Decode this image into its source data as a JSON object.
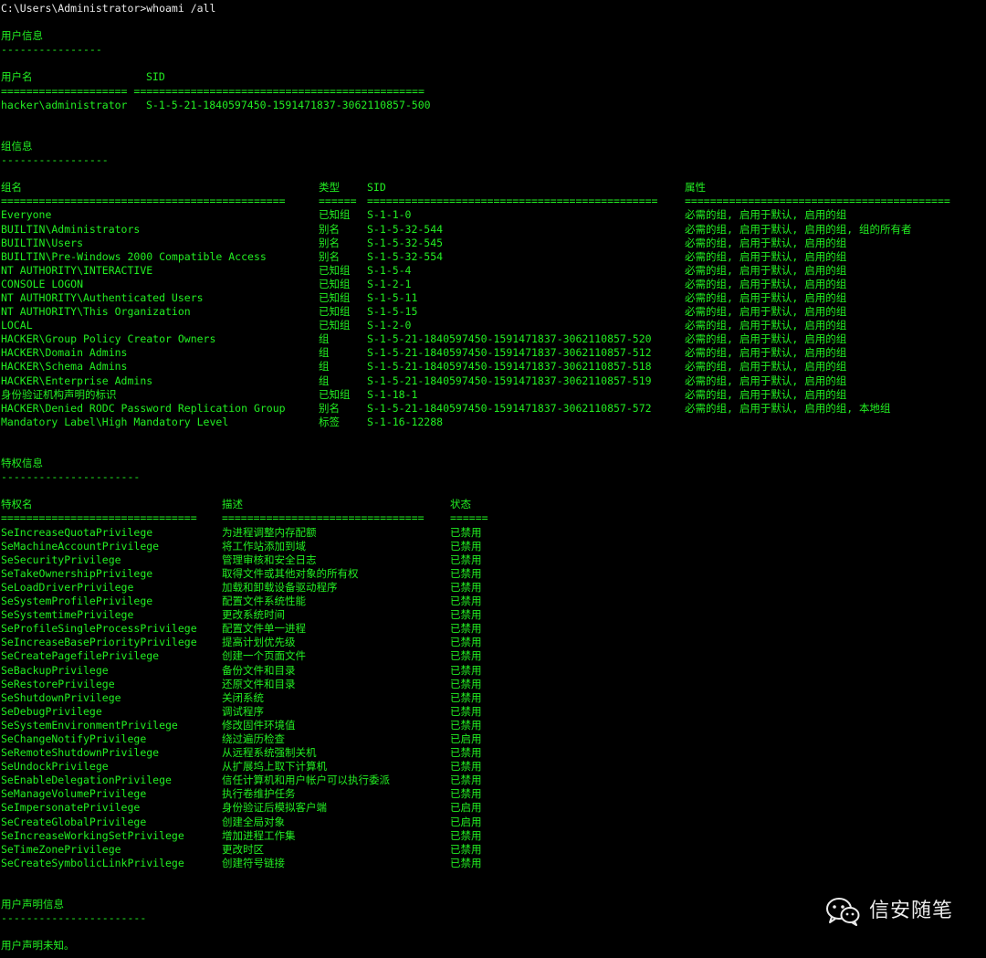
{
  "prompt": "C:\\Users\\Administrator>whoami /all",
  "user_section": {
    "title": "用户信息",
    "dashes": "----------------",
    "headers": {
      "name": "用户名",
      "sid": "SID"
    },
    "separator": "==================== ==============================================",
    "row": {
      "name": "hacker\\administrator",
      "sid": "S-1-5-21-1840597450-1591471837-3062110857-500"
    }
  },
  "group_section": {
    "title": "组信息",
    "dashes": "-----------------",
    "headers": {
      "name": "组名",
      "type": "类型",
      "sid": "SID",
      "attr": "属性"
    },
    "separators": {
      "name": "=============================================",
      "type": "======",
      "sid": "==============================================",
      "attr": "=========================================="
    },
    "rows": [
      {
        "name": "Everyone",
        "type": "已知组",
        "sid": "S-1-1-0",
        "attr": "必需的组, 启用于默认, 启用的组"
      },
      {
        "name": "BUILTIN\\Administrators",
        "type": "别名",
        "sid": "S-1-5-32-544",
        "attr": "必需的组, 启用于默认, 启用的组, 组的所有者"
      },
      {
        "name": "BUILTIN\\Users",
        "type": "别名",
        "sid": "S-1-5-32-545",
        "attr": "必需的组, 启用于默认, 启用的组"
      },
      {
        "name": "BUILTIN\\Pre-Windows 2000 Compatible Access",
        "type": "别名",
        "sid": "S-1-5-32-554",
        "attr": "必需的组, 启用于默认, 启用的组"
      },
      {
        "name": "NT AUTHORITY\\INTERACTIVE",
        "type": "已知组",
        "sid": "S-1-5-4",
        "attr": "必需的组, 启用于默认, 启用的组"
      },
      {
        "name": "CONSOLE LOGON",
        "type": "已知组",
        "sid": "S-1-2-1",
        "attr": "必需的组, 启用于默认, 启用的组"
      },
      {
        "name": "NT AUTHORITY\\Authenticated Users",
        "type": "已知组",
        "sid": "S-1-5-11",
        "attr": "必需的组, 启用于默认, 启用的组"
      },
      {
        "name": "NT AUTHORITY\\This Organization",
        "type": "已知组",
        "sid": "S-1-5-15",
        "attr": "必需的组, 启用于默认, 启用的组"
      },
      {
        "name": "LOCAL",
        "type": "已知组",
        "sid": "S-1-2-0",
        "attr": "必需的组, 启用于默认, 启用的组"
      },
      {
        "name": "HACKER\\Group Policy Creator Owners",
        "type": "组",
        "sid": "S-1-5-21-1840597450-1591471837-3062110857-520",
        "attr": "必需的组, 启用于默认, 启用的组"
      },
      {
        "name": "HACKER\\Domain Admins",
        "type": "组",
        "sid": "S-1-5-21-1840597450-1591471837-3062110857-512",
        "attr": "必需的组, 启用于默认, 启用的组"
      },
      {
        "name": "HACKER\\Schema Admins",
        "type": "组",
        "sid": "S-1-5-21-1840597450-1591471837-3062110857-518",
        "attr": "必需的组, 启用于默认, 启用的组"
      },
      {
        "name": "HACKER\\Enterprise Admins",
        "type": "组",
        "sid": "S-1-5-21-1840597450-1591471837-3062110857-519",
        "attr": "必需的组, 启用于默认, 启用的组"
      },
      {
        "name": "身份验证机构声明的标识",
        "type": "已知组",
        "sid": "S-1-18-1",
        "attr": "必需的组, 启用于默认, 启用的组"
      },
      {
        "name": "HACKER\\Denied RODC Password Replication Group",
        "type": "别名",
        "sid": "S-1-5-21-1840597450-1591471837-3062110857-572",
        "attr": "必需的组, 启用于默认, 启用的组, 本地组"
      },
      {
        "name": "Mandatory Label\\High Mandatory Level",
        "type": "标签",
        "sid": "S-1-16-12288",
        "attr": ""
      }
    ]
  },
  "privilege_section": {
    "title": "特权信息",
    "dashes": "----------------------",
    "headers": {
      "name": "特权名",
      "desc": "描述",
      "state": "状态"
    },
    "separators": {
      "name": "===============================",
      "desc": "================================",
      "state": "======"
    },
    "rows": [
      {
        "name": "SeIncreaseQuotaPrivilege",
        "desc": "为进程调整内存配额",
        "state": "已禁用"
      },
      {
        "name": "SeMachineAccountPrivilege",
        "desc": "将工作站添加到域",
        "state": "已禁用"
      },
      {
        "name": "SeSecurityPrivilege",
        "desc": "管理审核和安全日志",
        "state": "已禁用"
      },
      {
        "name": "SeTakeOwnershipPrivilege",
        "desc": "取得文件或其他对象的所有权",
        "state": "已禁用"
      },
      {
        "name": "SeLoadDriverPrivilege",
        "desc": "加载和卸载设备驱动程序",
        "state": "已禁用"
      },
      {
        "name": "SeSystemProfilePrivilege",
        "desc": "配置文件系统性能",
        "state": "已禁用"
      },
      {
        "name": "SeSystemtimePrivilege",
        "desc": "更改系统时间",
        "state": "已禁用"
      },
      {
        "name": "SeProfileSingleProcessPrivilege",
        "desc": "配置文件单一进程",
        "state": "已禁用"
      },
      {
        "name": "SeIncreaseBasePriorityPrivilege",
        "desc": "提高计划优先级",
        "state": "已禁用"
      },
      {
        "name": "SeCreatePagefilePrivilege",
        "desc": "创建一个页面文件",
        "state": "已禁用"
      },
      {
        "name": "SeBackupPrivilege",
        "desc": "备份文件和目录",
        "state": "已禁用"
      },
      {
        "name": "SeRestorePrivilege",
        "desc": "还原文件和目录",
        "state": "已禁用"
      },
      {
        "name": "SeShutdownPrivilege",
        "desc": "关闭系统",
        "state": "已禁用"
      },
      {
        "name": "SeDebugPrivilege",
        "desc": "调试程序",
        "state": "已禁用"
      },
      {
        "name": "SeSystemEnvironmentPrivilege",
        "desc": "修改固件环境值",
        "state": "已禁用"
      },
      {
        "name": "SeChangeNotifyPrivilege",
        "desc": "绕过遍历检查",
        "state": "已启用"
      },
      {
        "name": "SeRemoteShutdownPrivilege",
        "desc": "从远程系统强制关机",
        "state": "已禁用"
      },
      {
        "name": "SeUndockPrivilege",
        "desc": "从扩展坞上取下计算机",
        "state": "已禁用"
      },
      {
        "name": "SeEnableDelegationPrivilege",
        "desc": "信任计算机和用户帐户可以执行委派",
        "state": "已禁用"
      },
      {
        "name": "SeManageVolumePrivilege",
        "desc": "执行卷维护任务",
        "state": "已禁用"
      },
      {
        "name": "SeImpersonatePrivilege",
        "desc": "身份验证后模拟客户端",
        "state": "已启用"
      },
      {
        "name": "SeCreateGlobalPrivilege",
        "desc": "创建全局对象",
        "state": "已启用"
      },
      {
        "name": "SeIncreaseWorkingSetPrivilege",
        "desc": "增加进程工作集",
        "state": "已禁用"
      },
      {
        "name": "SeTimeZonePrivilege",
        "desc": "更改时区",
        "state": "已禁用"
      },
      {
        "name": "SeCreateSymbolicLinkPrivilege",
        "desc": "创建符号链接",
        "state": "已禁用"
      }
    ]
  },
  "claims_section": {
    "title": "用户声明信息",
    "dashes": "-----------------------",
    "message": "用户声明未知。"
  },
  "watermark": {
    "text": "信安随笔",
    "icon": "wechat-icon"
  }
}
